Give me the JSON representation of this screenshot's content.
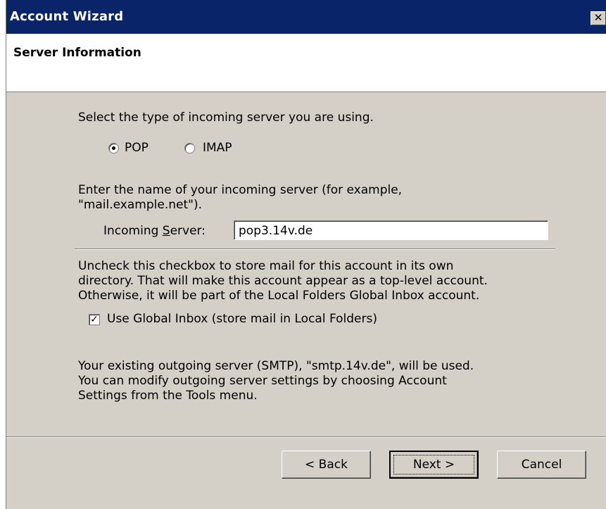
{
  "window": {
    "title": "Account Wizard",
    "close_label": "✕"
  },
  "header": {
    "heading": "Server Information"
  },
  "server_type": {
    "prompt": "Select the type of incoming server you are using.",
    "options": [
      {
        "label": "POP",
        "selected": true
      },
      {
        "label": "IMAP",
        "selected": false
      }
    ]
  },
  "incoming": {
    "instruction_line1": "Enter the name of your incoming server (for example,",
    "instruction_line2": "\"mail.example.net\").",
    "label_pre": "Incoming ",
    "label_access": "S",
    "label_post": "erver:",
    "value": "pop3.14v.de"
  },
  "global_inbox": {
    "text_line1": "Uncheck this checkbox to store mail for this account in its own",
    "text_line2": "directory. That will make this account appear as a top-level account.",
    "text_line3": "Otherwise, it will be part of the Local Folders Global Inbox account.",
    "checkbox_label": "Use Global Inbox (store mail in Local Folders)",
    "checked": true
  },
  "smtp_note": {
    "line1": "Your existing outgoing server (SMTP), \"smtp.14v.de\", will be used.",
    "line2": "You can modify outgoing server settings by choosing Account",
    "line3": "Settings from the Tools menu."
  },
  "buttons": {
    "back": "< Back",
    "next": "Next >",
    "cancel": "Cancel"
  }
}
